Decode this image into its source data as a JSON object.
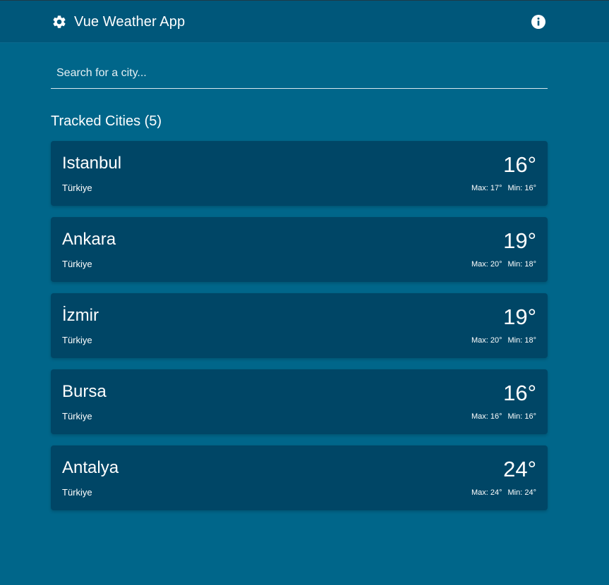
{
  "header": {
    "title": "Vue Weather App",
    "logo_icon": "gear-icon",
    "info_icon": "info-icon"
  },
  "search": {
    "placeholder": "Search for a city...",
    "value": ""
  },
  "tracked": {
    "title": "Tracked Cities (5)",
    "cities": [
      {
        "name": "Istanbul",
        "country": "Türkiye",
        "temp": "16°",
        "max": "Max: 17°",
        "min": "Min: 16°"
      },
      {
        "name": "Ankara",
        "country": "Türkiye",
        "temp": "19°",
        "max": "Max: 20°",
        "min": "Min: 18°"
      },
      {
        "name": "İzmir",
        "country": "Türkiye",
        "temp": "19°",
        "max": "Max: 20°",
        "min": "Min: 18°"
      },
      {
        "name": "Bursa",
        "country": "Türkiye",
        "temp": "16°",
        "max": "Max: 16°",
        "min": "Min: 16°"
      },
      {
        "name": "Antalya",
        "country": "Türkiye",
        "temp": "24°",
        "max": "Max: 24°",
        "min": "Min: 24°"
      }
    ]
  },
  "colors": {
    "background": "#00668a",
    "header": "#00577a",
    "card": "#004666",
    "text": "#ffffff"
  }
}
